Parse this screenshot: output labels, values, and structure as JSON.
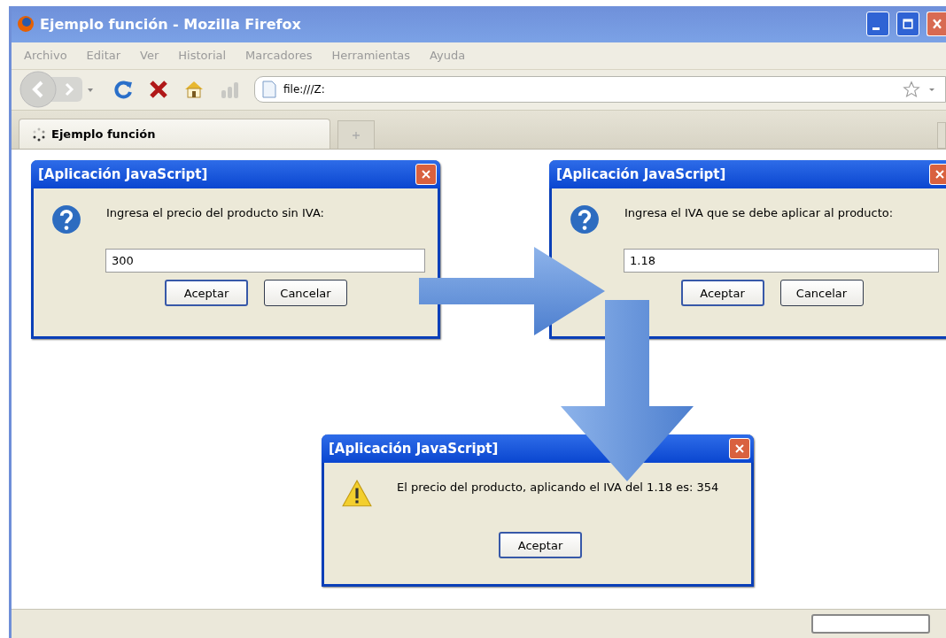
{
  "window": {
    "title": "Ejemplo función - Mozilla Firefox"
  },
  "menu": [
    "Archivo",
    "Editar",
    "Ver",
    "Historial",
    "Marcadores",
    "Herramientas",
    "Ayuda"
  ],
  "address": {
    "value": "file:///Z:"
  },
  "tabs": [
    {
      "label": "Ejemplo función",
      "selected": true
    }
  ],
  "dialogs": [
    {
      "title": "[Aplicación JavaScript]",
      "kind": "question",
      "message": "Ingresa el precio del producto sin IVA:",
      "input": "300",
      "buttons": [
        {
          "label": "Aceptar",
          "default": true
        },
        {
          "label": "Cancelar",
          "default": false
        }
      ]
    },
    {
      "title": "[Aplicación JavaScript]",
      "kind": "question",
      "message": "Ingresa el IVA que se debe aplicar al producto:",
      "input": "1.18",
      "buttons": [
        {
          "label": "Aceptar",
          "default": true
        },
        {
          "label": "Cancelar",
          "default": false
        }
      ]
    },
    {
      "title": "[Aplicación JavaScript]",
      "kind": "warning",
      "message": "El precio del producto, aplicando el IVA del 1.18 es: 354",
      "buttons": [
        {
          "label": "Aceptar",
          "default": true
        }
      ]
    }
  ]
}
